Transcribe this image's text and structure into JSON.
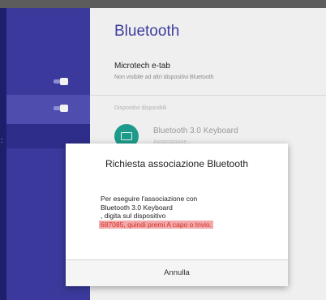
{
  "settings": {
    "title": "Bluetooth",
    "device_name": "Microtech e-tab",
    "device_visibility": "Non visibile ad altri dispositivi Bluetooth",
    "section_label": "Dispositivi disponibili",
    "available": [
      {
        "name": "Bluetooth 3.0 Keyboard",
        "status": "Associazione...",
        "icon": "keyboard-icon"
      }
    ]
  },
  "dialog": {
    "title": "Richiesta associazione Bluetooth",
    "line1": "Per eseguire l'associazione con",
    "line2": "Bluetooth 3.0 Keyboard",
    "line3": ", digita sul dispositivo",
    "line4": "687085, quindi premi A capo o Invio.",
    "cancel_label": "Annulla"
  },
  "colors": {
    "accent": "#3d3d9e",
    "left_panel": "#3b3a9c",
    "device_icon": "#1d9a8a",
    "highlight": "#f3a9a9",
    "highlight_text": "#d0342c"
  }
}
